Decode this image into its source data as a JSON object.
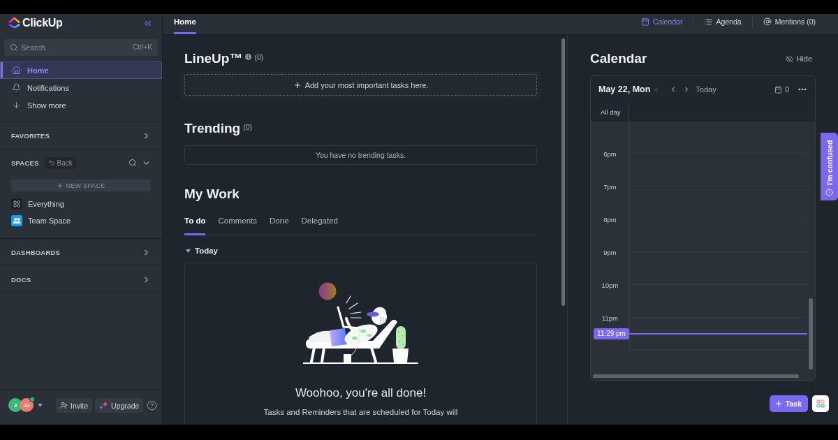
{
  "sidebar": {
    "logo": "ClickUp",
    "search": {
      "placeholder": "Search",
      "shortcut": "Ctrl+K"
    },
    "nav": [
      {
        "label": "Home",
        "kind": "home",
        "selected": true
      },
      {
        "label": "Notifications",
        "kind": "notifications",
        "selected": false
      },
      {
        "label": "Show more",
        "kind": "more",
        "selected": false
      }
    ],
    "favorites": {
      "label": "FAVORITES"
    },
    "spaces": {
      "label": "SPACES",
      "back": "Back",
      "new_space": "NEW SPACE",
      "items": [
        {
          "label": "Everything",
          "kind": "all"
        },
        {
          "label": "Team Space",
          "kind": "team"
        }
      ]
    },
    "dashboards": {
      "label": "DASHBOARDS"
    },
    "docs": {
      "label": "DOCS"
    },
    "footer": {
      "avatars": [
        {
          "initials": "J",
          "color": "#3cba7e",
          "online": false
        },
        {
          "initials": "JJ",
          "color": "#f07a6c",
          "online": true
        }
      ],
      "invite": "Invite",
      "upgrade": "Upgrade"
    }
  },
  "header": {
    "tabs": [
      {
        "label": "Home",
        "selected": true
      }
    ],
    "views": [
      {
        "label": "Calendar",
        "kind": "calendar",
        "selected": true
      },
      {
        "label": "Agenda",
        "kind": "agenda",
        "selected": false
      },
      {
        "label": "Mentions (0)",
        "kind": "mentions",
        "selected": false
      }
    ]
  },
  "lineup": {
    "title": "LineUp™",
    "count": "(0)",
    "add": "Add your most important tasks here."
  },
  "trending": {
    "title": "Trending",
    "count": "(0)",
    "empty": "You have no trending tasks."
  },
  "my_work": {
    "title": "My Work",
    "tabs": [
      {
        "label": "To do",
        "selected": true
      },
      {
        "label": "Comments",
        "selected": false
      },
      {
        "label": "Done",
        "selected": false
      },
      {
        "label": "Delegated",
        "selected": false
      }
    ],
    "groups": [
      {
        "label": "Today",
        "expanded": true
      }
    ],
    "empty": {
      "title": "Woohoo, you're all done!",
      "text": "Tasks and Reminders that are scheduled for Today will"
    }
  },
  "calendar": {
    "title": "Calendar",
    "hide": "Hide",
    "date": "May 22, Mon",
    "today": "Today",
    "count": "0",
    "all_day": "All day",
    "hours": [
      "6pm",
      "7pm",
      "8pm",
      "9pm",
      "10pm",
      "11pm"
    ],
    "now": "11:29 pm"
  },
  "feedback": {
    "label": "I'm confused"
  },
  "quick_add": {
    "label": "Task"
  }
}
